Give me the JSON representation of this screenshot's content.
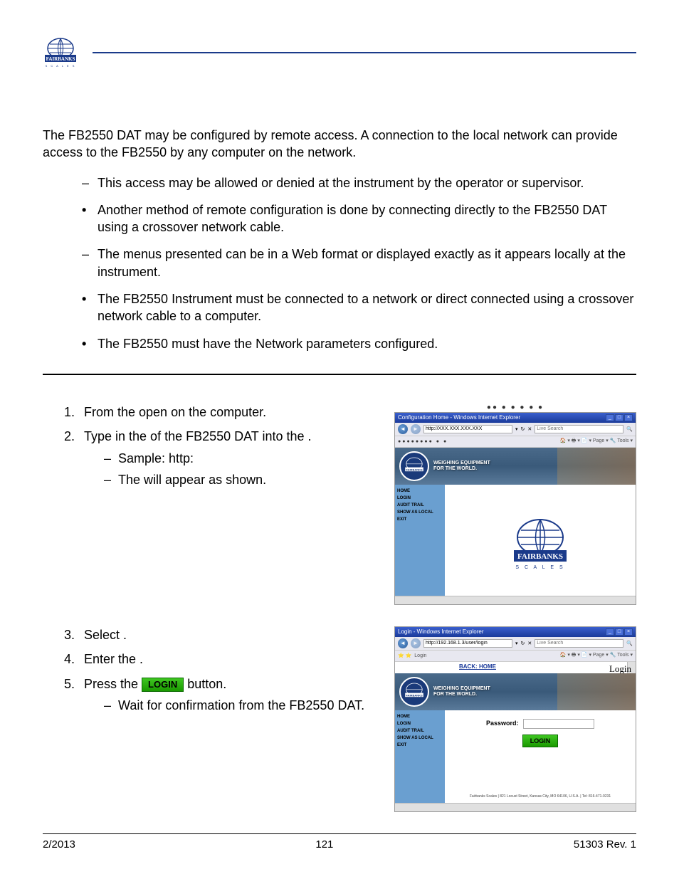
{
  "header": {
    "logo_text": "FAIRBANKS"
  },
  "intro": "The FB2550 DAT may be configured by remote access.  A connection to the local network can provide access to the FB2550 by any computer on the network.",
  "bullets": [
    {
      "style": "dash",
      "text": "This access may be allowed or denied at the instrument by the operator or supervisor."
    },
    {
      "style": "dot",
      "text": "Another method of remote configuration is done by connecting directly to the FB2550 DAT using a crossover network cable."
    },
    {
      "style": "dash",
      "text": "The menus presented can be in a Web format or displayed exactly as it appears locally at the instrument."
    },
    {
      "style": "dot",
      "text": "The FB2550 Instrument must be connected to a network or direct connected using a crossover network cable to a computer."
    },
    {
      "style": "dot",
      "text": "The FB2550 must have the Network parameters configured."
    }
  ],
  "steps_block_a": [
    {
      "num": "1.",
      "text": "From the                                open                                          on the computer."
    },
    {
      "num": "2.",
      "text": "Type in the                         of the FB2550 DAT into the                    .",
      "subs": [
        "Sample: http:",
        "The                                                will appear as shown."
      ]
    }
  ],
  "steps_block_b": [
    {
      "num": "3.",
      "text": "Select             ."
    },
    {
      "num": "4.",
      "text": "Enter the                                       ."
    },
    {
      "num": "5.",
      "text_pre": "Press the ",
      "text_post": " button.",
      "subs": [
        "Wait for confirmation from the FB2550 DAT."
      ]
    }
  ],
  "screenshot1": {
    "title": "Configuration Home - Windows Internet Explorer",
    "url": "http://XXX.XXX.XXX.XXX",
    "search_placeholder": "Live Search",
    "toolbar2_right": "🏠 ▾  🖶 ▾  📄 ▾  Page ▾  🔧 Tools ▾",
    "tagline_line1": "WEIGHING EQUIPMENT",
    "tagline_line2": "FOR THE WORLD.",
    "main_title": "Configuration Home",
    "nav": [
      "HOME",
      "LOGIN",
      "AUDIT TRAIL",
      "SHOW AS LOCAL",
      "EXIT"
    ],
    "center_brand": "FAIRBANKS"
  },
  "screenshot2": {
    "title": "Login - Windows Internet Explorer",
    "url": "http://192.168.1.3/user/login",
    "search_placeholder": "Live Search",
    "toolbar2_left": "Login",
    "toolbar2_right": "🏠 ▾  🖶 ▾  📄 ▾  Page ▾  🔧 Tools ▾",
    "back_home": "BACK: HOME",
    "main_title": "Login",
    "tagline_line1": "WEIGHING EQUIPMENT",
    "tagline_line2": "FOR THE WORLD.",
    "nav": [
      "HOME",
      "LOGIN",
      "AUDIT TRAIL",
      "SHOW AS LOCAL",
      "EXIT"
    ],
    "password_label": "Password:",
    "login_button": "LOGIN",
    "footer": "Fairbanks Scales | 821 Locust Street, Kansas City, MO 64106, U.S.A. | Tel: 816-471-0231"
  },
  "inline_login_button": "LOGIN",
  "footer": {
    "left": "2/2013",
    "center": "121",
    "right": "51303     Rev. 1"
  }
}
